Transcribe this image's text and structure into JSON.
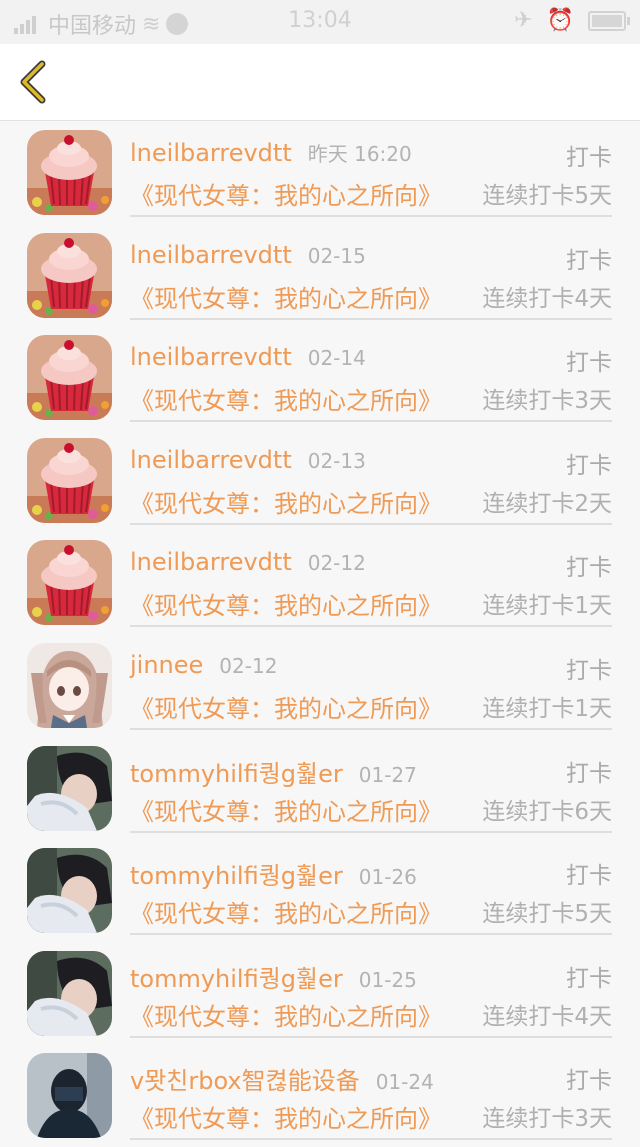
{
  "status_bar": {
    "carrier": "中国移动",
    "time": "13:04"
  },
  "nav": {
    "back_icon": "chevron-left-icon",
    "accent": "#e0b92a"
  },
  "colors": {
    "username": "#ef9a55",
    "book": "#ef9a55",
    "meta": "#b0b0b0"
  },
  "records": [
    {
      "username": "lneilbarrevdtt",
      "date": "昨天 16:20",
      "tag": "打卡",
      "book": "《现代女尊：我的心之所向》",
      "streak": "连续打卡5天",
      "avatar": "cupcake"
    },
    {
      "username": "lneilbarrevdtt",
      "date": "02-15",
      "tag": "打卡",
      "book": "《现代女尊：我的心之所向》",
      "streak": "连续打卡4天",
      "avatar": "cupcake"
    },
    {
      "username": "lneilbarrevdtt",
      "date": "02-14",
      "tag": "打卡",
      "book": "《现代女尊：我的心之所向》",
      "streak": "连续打卡3天",
      "avatar": "cupcake"
    },
    {
      "username": "lneilbarrevdtt",
      "date": "02-13",
      "tag": "打卡",
      "book": "《现代女尊：我的心之所向》",
      "streak": "连续打卡2天",
      "avatar": "cupcake"
    },
    {
      "username": "lneilbarrevdtt",
      "date": "02-12",
      "tag": "打卡",
      "book": "《现代女尊：我的心之所向》",
      "streak": "连续打卡1天",
      "avatar": "cupcake"
    },
    {
      "username": "jinnee",
      "date": "02-12",
      "tag": "打卡",
      "book": "《现代女尊：我的心之所向》",
      "streak": "连续打卡1天",
      "avatar": "anime"
    },
    {
      "username": "tommyhilfi퀑g훭er",
      "date": "01-27",
      "tag": "打卡",
      "book": "《现代女尊：我的心之所向》",
      "streak": "连续打卡6天",
      "avatar": "photo"
    },
    {
      "username": "tommyhilfi퀑g훭er",
      "date": "01-26",
      "tag": "打卡",
      "book": "《现代女尊：我的心之所向》",
      "streak": "连续打卡5天",
      "avatar": "photo"
    },
    {
      "username": "tommyhilfi퀑g훭er",
      "date": "01-25",
      "tag": "打卡",
      "book": "《现代女尊：我的心之所向》",
      "streak": "连续打卡4天",
      "avatar": "photo"
    },
    {
      "username": "v뫗친rbox智켢能设备",
      "date": "01-24",
      "tag": "打卡",
      "book": "《现代女尊：我的心之所向》",
      "streak": "连续打卡3天",
      "avatar": "dark"
    }
  ]
}
